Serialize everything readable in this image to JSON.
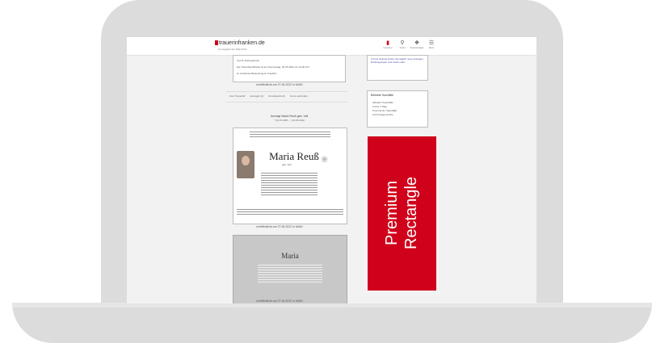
{
  "site": {
    "logo_text": "trauerinfranken.de",
    "logo_sub": "ein Angebot der Main-Post"
  },
  "nav": {
    "items": [
      {
        "label": "Inserieren",
        "icon": "bookmark-icon"
      },
      {
        "label": "Suche",
        "icon": "search-icon"
      },
      {
        "label": "Traueranzeigen",
        "icon": "candle-icon"
      },
      {
        "label": "Menü",
        "icon": "menu-icon"
      }
    ]
  },
  "main": {
    "card1_line1": "und Ihr Dazugehören.",
    "card1_line2": "Die Trauerfeierlichkeit ist am Donnerstag, 30.06.2022 um 14.00 Uhr",
    "card1_line3": "im Anschluss Beisetzung im Friedhof.",
    "published_1": "veröffentlicht am 27.06.2022 in MAIN",
    "actions": [
      {
        "label": "Zum Trauerfall"
      },
      {
        "label": "Anzeigen (2)"
      },
      {
        "label": "Kondolenzbuch"
      },
      {
        "label": "Kerze anzünden"
      }
    ],
    "announcement_title": "Anzeige Maria Reuß geb. Voll",
    "announcement_dates": "* 01.05.1935 – † 24.06.2022",
    "card2_name": "Maria Reuß",
    "card2_sub": "geb. Voll",
    "published_2": "veröffentlicht am 27.06.2022 in MAIN",
    "card3_name": "Maria",
    "published_3": "veröffentlicht am 27.06.2022 in MAIN"
  },
  "sidebar": {
    "link_text": "In Ihrer Zeitung finden Sie täglich neue Anzeigen, Danksagungen und vieles mehr.",
    "box_title": "Beliebte Suchfälle",
    "box_items": [
      "Aktuelle Trauerfälle",
      "Letzte 3 Tage",
      "Prominente Trauerfälle",
      "Auf Anzeigensuche"
    ]
  },
  "ad": {
    "line1": "Premium",
    "line2": "Rectangle",
    "color": "#d0021b"
  }
}
